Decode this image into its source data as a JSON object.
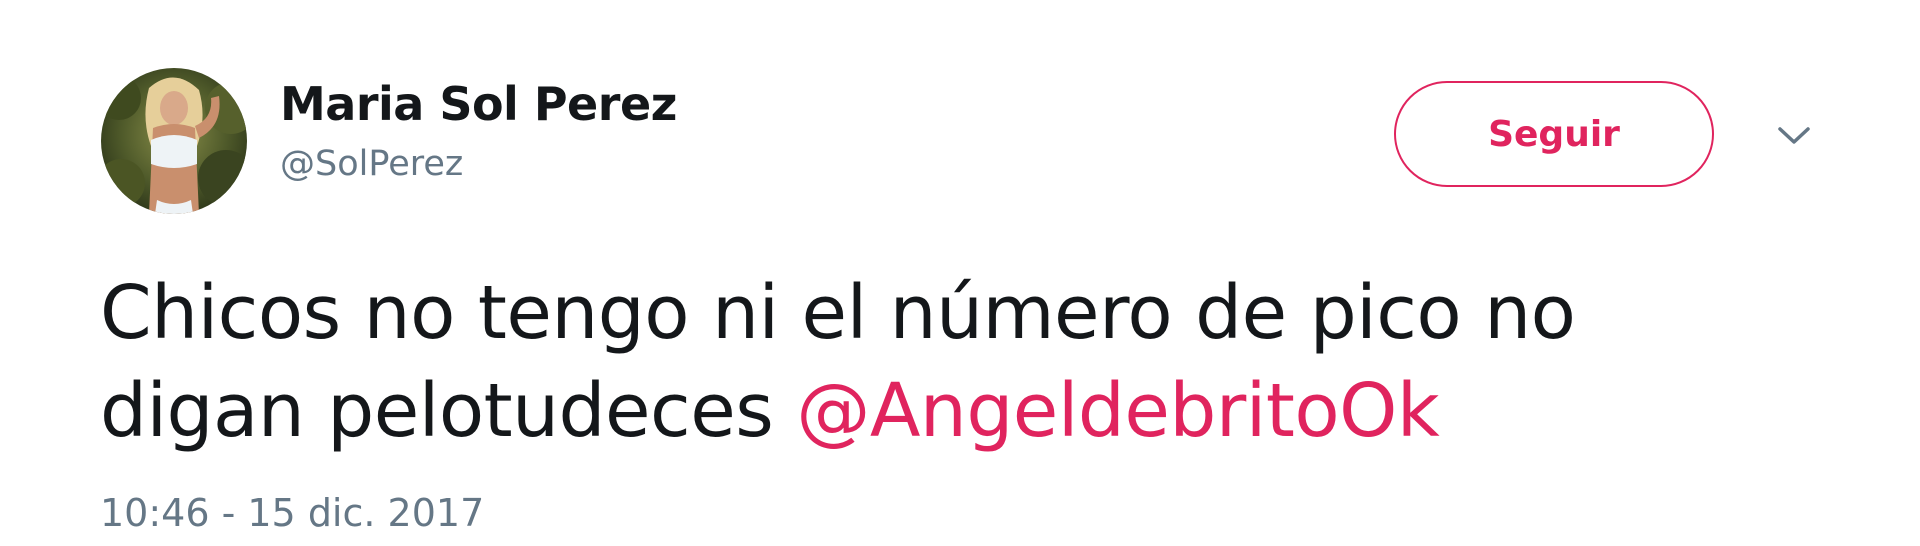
{
  "tweet": {
    "author": {
      "display_name": "Maria Sol Perez",
      "username": "@SolPerez",
      "avatar_icon": "profile-photo"
    },
    "follow_button_label": "Seguir",
    "menu_icon": "chevron-down-icon",
    "text_line1": "Chicos no tengo ni el número de pico no",
    "text_line2": "digan pelotudeces ",
    "mention": "@AngeldebritoOk",
    "timestamp": "10:46 - 15 dic. 2017"
  },
  "colors": {
    "accent": "#e0245e",
    "text": "#14171a",
    "secondary": "#657786"
  }
}
